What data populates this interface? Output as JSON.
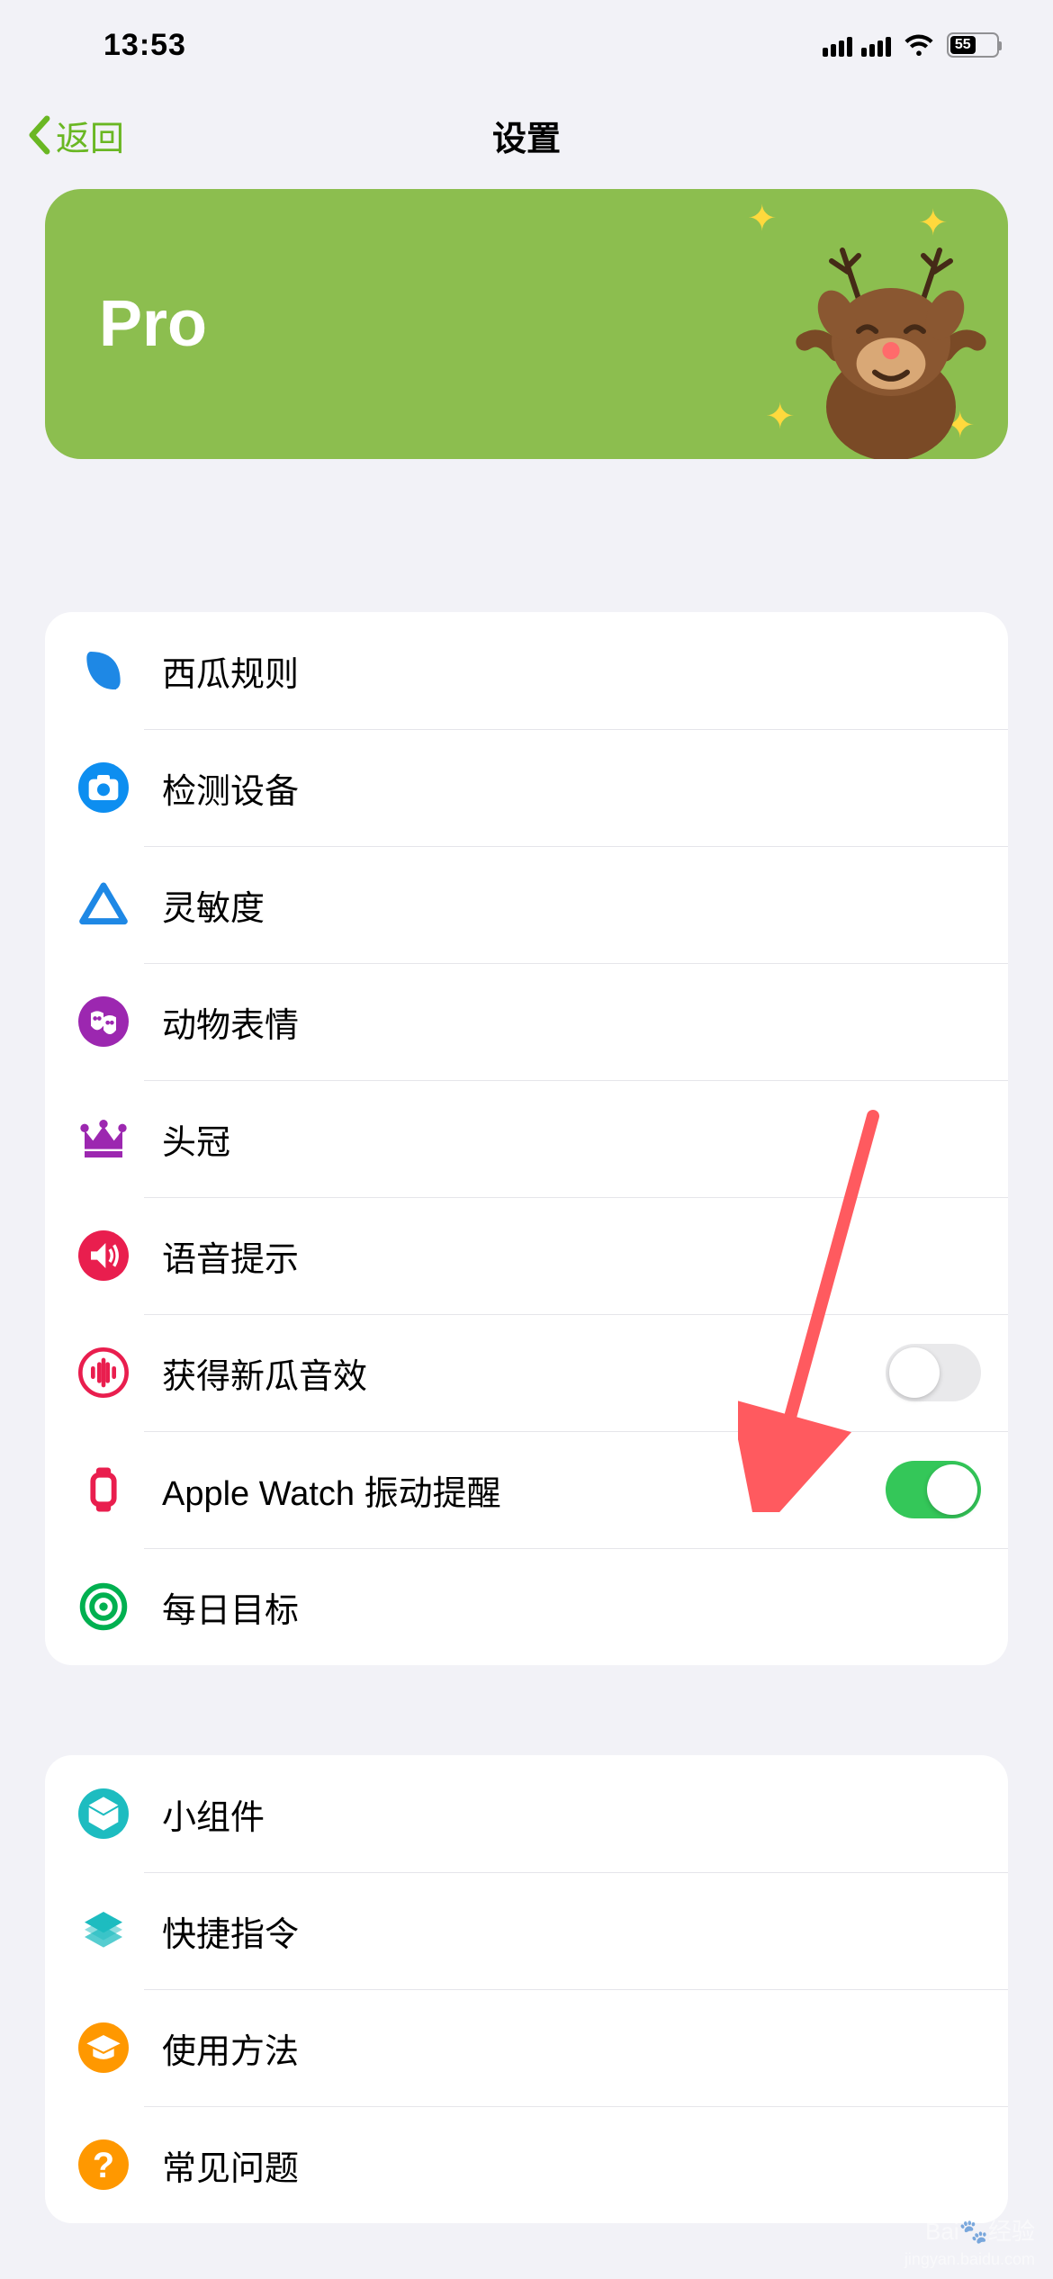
{
  "status": {
    "time": "13:53",
    "battery": "55"
  },
  "nav": {
    "back": "返回",
    "title": "设置"
  },
  "pro": {
    "label": "Pro"
  },
  "section1": {
    "items": [
      {
        "label": "西瓜规则",
        "type": "link"
      },
      {
        "label": "检测设备",
        "type": "link"
      },
      {
        "label": "灵敏度",
        "type": "link"
      },
      {
        "label": "动物表情",
        "type": "link"
      },
      {
        "label": "头冠",
        "type": "link"
      },
      {
        "label": "语音提示",
        "type": "link"
      },
      {
        "label": "获得新瓜音效",
        "type": "toggle",
        "on": false
      },
      {
        "label": "Apple Watch 振动提醒",
        "type": "toggle",
        "on": true
      },
      {
        "label": "每日目标",
        "type": "link"
      }
    ]
  },
  "section2": {
    "items": [
      {
        "label": "小组件",
        "type": "link"
      },
      {
        "label": "快捷指令",
        "type": "link"
      },
      {
        "label": "使用方法",
        "type": "link"
      },
      {
        "label": "常见问题",
        "type": "link"
      }
    ]
  },
  "watermark": {
    "line1": "Bai",
    "line2": "经验",
    "line3": "jingyan.baidu.com"
  }
}
